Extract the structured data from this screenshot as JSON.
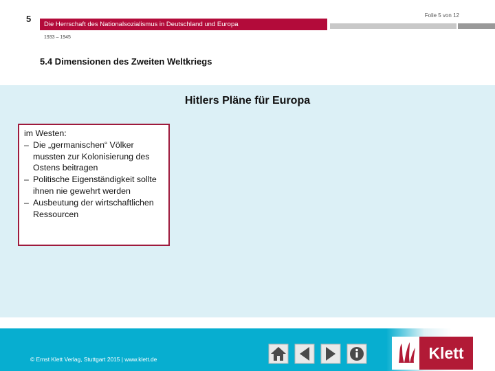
{
  "header": {
    "chapter_number": "5",
    "title": "Die Herrschaft des Nationalsozialismus in Deutschland und Europa",
    "years": "1933 – 1945",
    "slide_counter": "Folie 5 von 12"
  },
  "section": {
    "title": "5.4 Dimensionen des Zweiten Weltkriegs"
  },
  "main": {
    "heading": "Hitlers Pläne für Europa",
    "box": {
      "title": "im Westen:",
      "items": [
        "Die „germanischen“ Völker mussten zur Kolonisierung des Ostens beitragen",
        "Politische Eigenständigkeit sollte ihnen nie gewehrt werden",
        "Ausbeutung der wirtschaftlichen Ressourcen"
      ]
    }
  },
  "footer": {
    "copyright": "© Ernst Klett Verlag, Stuttgart 2015 | www.klett.de",
    "nav": {
      "home_icon": "home-icon",
      "prev_icon": "arrow-left-icon",
      "next_icon": "arrow-right-icon",
      "info_icon": "info-icon"
    },
    "logo_text": "Klett"
  },
  "colors": {
    "accent_red": "#b30b3a",
    "content_bg": "#dcf0f6",
    "footer_blue": "#07aed0",
    "box_border": "#9e1a3c"
  }
}
